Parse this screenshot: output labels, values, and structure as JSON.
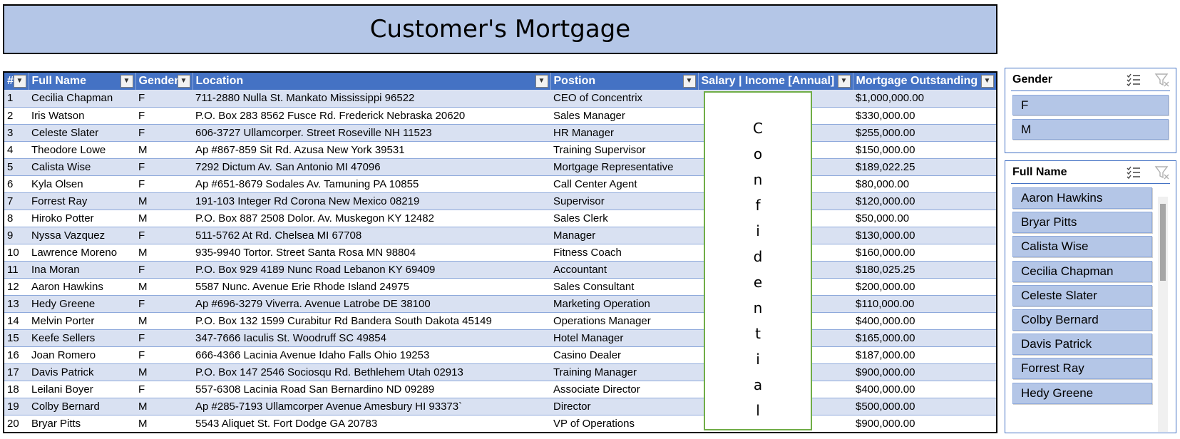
{
  "title": "Customer's Mortgage",
  "table": {
    "headers": [
      "#",
      "Full Name",
      "Gender",
      "Location",
      "Postion",
      "Salary | Income [Annual]",
      "Mortgage Outstanding"
    ],
    "rows": [
      [
        "1",
        "Cecilia Chapman",
        "F",
        "711-2880 Nulla St. Mankato Mississippi 96522",
        "CEO of Concentrix",
        "",
        "$1,000,000.00"
      ],
      [
        "2",
        "Iris Watson",
        "F",
        "P.O. Box 283 8562 Fusce Rd.  Frederick Nebraska 20620",
        "Sales Manager",
        "",
        "$330,000.00"
      ],
      [
        "3",
        "Celeste Slater",
        "F",
        "606-3727 Ullamcorper. Street  Roseville NH 11523",
        "HR Manager",
        "",
        "$255,000.00"
      ],
      [
        "4",
        "Theodore Lowe",
        "M",
        "Ap #867-859 Sit Rd.  Azusa New York 39531",
        "Training Supervisor",
        "",
        "$150,000.00"
      ],
      [
        "5",
        "Calista Wise",
        "F",
        "7292 Dictum Av.  San Antonio MI 47096",
        "Mortgage Representative",
        "",
        "$189,022.25"
      ],
      [
        "6",
        "Kyla Olsen",
        "F",
        "Ap #651-8679 Sodales Av. Tamuning PA 10855",
        "Call Center Agent",
        "",
        "$80,000.00"
      ],
      [
        "7",
        "Forrest Ray",
        "M",
        "191-103 Integer Rd Corona New Mexico 08219",
        "Supervisor",
        "",
        "$120,000.00"
      ],
      [
        "8",
        "Hiroko Potter",
        "M",
        "P.O. Box 887 2508 Dolor. Av. Muskegon KY 12482",
        "Sales Clerk",
        "",
        "$50,000.00"
      ],
      [
        "9",
        "Nyssa Vazquez",
        "F",
        "511-5762 At Rd. Chelsea MI 67708",
        "Manager",
        "",
        "$130,000.00"
      ],
      [
        "10",
        "Lawrence Moreno",
        "M",
        "935-9940 Tortor. Street Santa Rosa MN 98804",
        "Fitness Coach",
        "",
        "$160,000.00"
      ],
      [
        "11",
        "Ina Moran",
        "F",
        "P.O. Box 929 4189 Nunc Road Lebanon KY 69409",
        "Accountant",
        "",
        "$180,025.25"
      ],
      [
        "12",
        "Aaron Hawkins",
        "M",
        "5587 Nunc. Avenue Erie Rhode Island 24975",
        "Sales Consultant",
        "",
        "$200,000.00"
      ],
      [
        "13",
        "Hedy Greene",
        "F",
        "Ap #696-3279 Viverra. Avenue Latrobe DE 38100",
        "Marketing Operation",
        "",
        "$110,000.00"
      ],
      [
        "14",
        "Melvin Porter",
        "M",
        "P.O. Box 132 1599 Curabitur Rd Bandera South Dakota 45149",
        "Operations Manager",
        "",
        "$400,000.00"
      ],
      [
        "15",
        "Keefe Sellers",
        "F",
        "347-7666 Iaculis St. Woodruff SC 49854",
        "Hotel Manager",
        "",
        "$165,000.00"
      ],
      [
        "16",
        "Joan Romero",
        "F",
        "666-4366 Lacinia Avenue Idaho Falls Ohio 19253",
        "Casino Dealer",
        "",
        "$187,000.00"
      ],
      [
        "17",
        "Davis Patrick",
        "M",
        "P.O. Box 147 2546 Sociosqu Rd. Bethlehem Utah 02913",
        "Training Manager",
        "",
        "$900,000.00"
      ],
      [
        "18",
        "Leilani Boyer",
        "F",
        "557-6308 Lacinia Road San Bernardino ND 09289",
        "Associate Director",
        "",
        "$400,000.00"
      ],
      [
        "19",
        "Colby Bernard",
        "M",
        "Ap #285-7193 Ullamcorper Avenue Amesbury HI 93373`",
        "Director",
        "",
        "$500,000.00"
      ],
      [
        "20",
        "Bryar Pitts",
        "M",
        "5543 Aliquet St. Fort Dodge GA 20783",
        "VP of Operations",
        "",
        "$900,000.00"
      ]
    ]
  },
  "confidential": "Confidential",
  "slicers": {
    "gender": {
      "title": "Gender",
      "items": [
        "F",
        "M"
      ]
    },
    "full_name": {
      "title": "Full Name",
      "items": [
        "Aaron Hawkins",
        "Bryar Pitts",
        "Calista Wise",
        "Cecilia Chapman",
        "Celeste Slater",
        "Colby Bernard",
        "Davis Patrick",
        "Forrest Ray",
        "Hedy Greene"
      ]
    }
  },
  "icons": {
    "multi_select": "multi-select-icon",
    "clear_filter": "clear-filter-icon",
    "filter_dropdown": "filter-dropdown-icon"
  },
  "colors": {
    "header": "#4472c4",
    "band": "#d9e1f2",
    "banner": "#b4c6e7",
    "slicer_item": "#b4c6e7",
    "confidential_border": "#70ad47"
  }
}
